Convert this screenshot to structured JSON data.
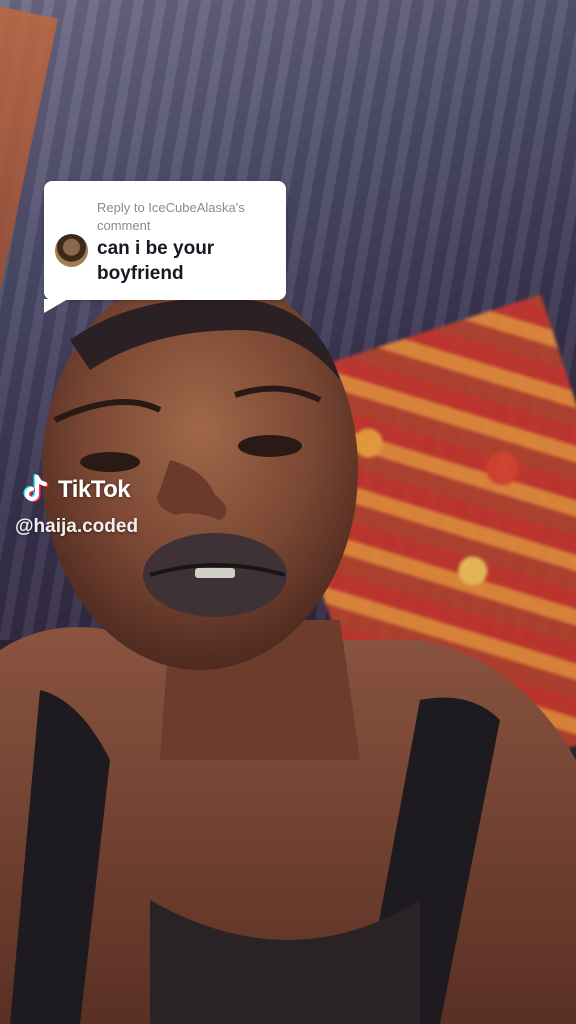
{
  "reply_card": {
    "reply_to": "Reply to IceCubeAlaska's comment",
    "comment_text": "can i be your boyfriend",
    "avatar_icon": "commenter-avatar"
  },
  "watermark": {
    "logo_icon": "tiktok-note-icon",
    "brand": "TikTok",
    "username": "@haija.coded"
  },
  "colors": {
    "bubble_bg": "#ffffff",
    "reply_to_text": "#8a8b91",
    "comment_text": "#161823",
    "tiktok_cyan": "#25f4ee",
    "tiktok_red": "#fe2c55"
  }
}
